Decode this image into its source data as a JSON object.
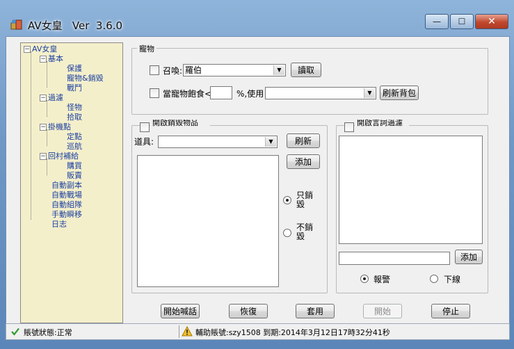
{
  "window": {
    "title": "AV女皇   Ver  3.6.0",
    "controls": {
      "minimize": "—",
      "maximize": "☐",
      "close": "✕"
    }
  },
  "tree": {
    "root": "AV女皇",
    "nodes": {
      "basic": "基本",
      "protect": "保護",
      "pet_sell": "寵物&銷毀",
      "battle": "戰鬥",
      "filter": "過濾",
      "monster": "怪物",
      "pickup": "拾取",
      "afk": "掛機點",
      "fixed": "定點",
      "patrol": "巡航",
      "village": "回村補給",
      "buy": "購買",
      "sell": "販賣",
      "dungeon": "自動副本",
      "arena": "自動戰場",
      "party": "自動組隊",
      "teleport": "手動瞬移",
      "log": "日志"
    }
  },
  "pet": {
    "group_title": "寵物",
    "summon_label": "召喚:",
    "summon_value": "羅伯",
    "read_button": "讀取",
    "satiety_label": "當寵物飽食<",
    "satiety_value": "",
    "use_label": "%,使用",
    "use_value": "",
    "refresh_bag_button": "刷新背包"
  },
  "destroy": {
    "group_title": "開啟銷毀物品",
    "item_label": "道具:",
    "item_value": "",
    "refresh_button": "刷新",
    "add_button": "添加",
    "only_destroy_label": "只銷毀",
    "no_destroy_label": "不銷毀",
    "items": []
  },
  "keyword": {
    "group_title": "開啟言詞過濾",
    "input_value": "",
    "add_button": "添加",
    "alarm_label": "報警",
    "logout_label": "下線",
    "items": []
  },
  "bottom_buttons": {
    "start_shout": "開始喊話",
    "restore": "恢復",
    "apply": "套用",
    "start": "開始",
    "stop": "停止"
  },
  "status": {
    "account_status": "賬號狀態:正常",
    "aux_account": "輔助賬號:szy1508 到期:2014年3月12日17時32分41秒"
  },
  "colors": {
    "tree_bg": "#f4efcb",
    "tree_text": "#1a3fa0",
    "frame_blue": "#6f98c6"
  }
}
